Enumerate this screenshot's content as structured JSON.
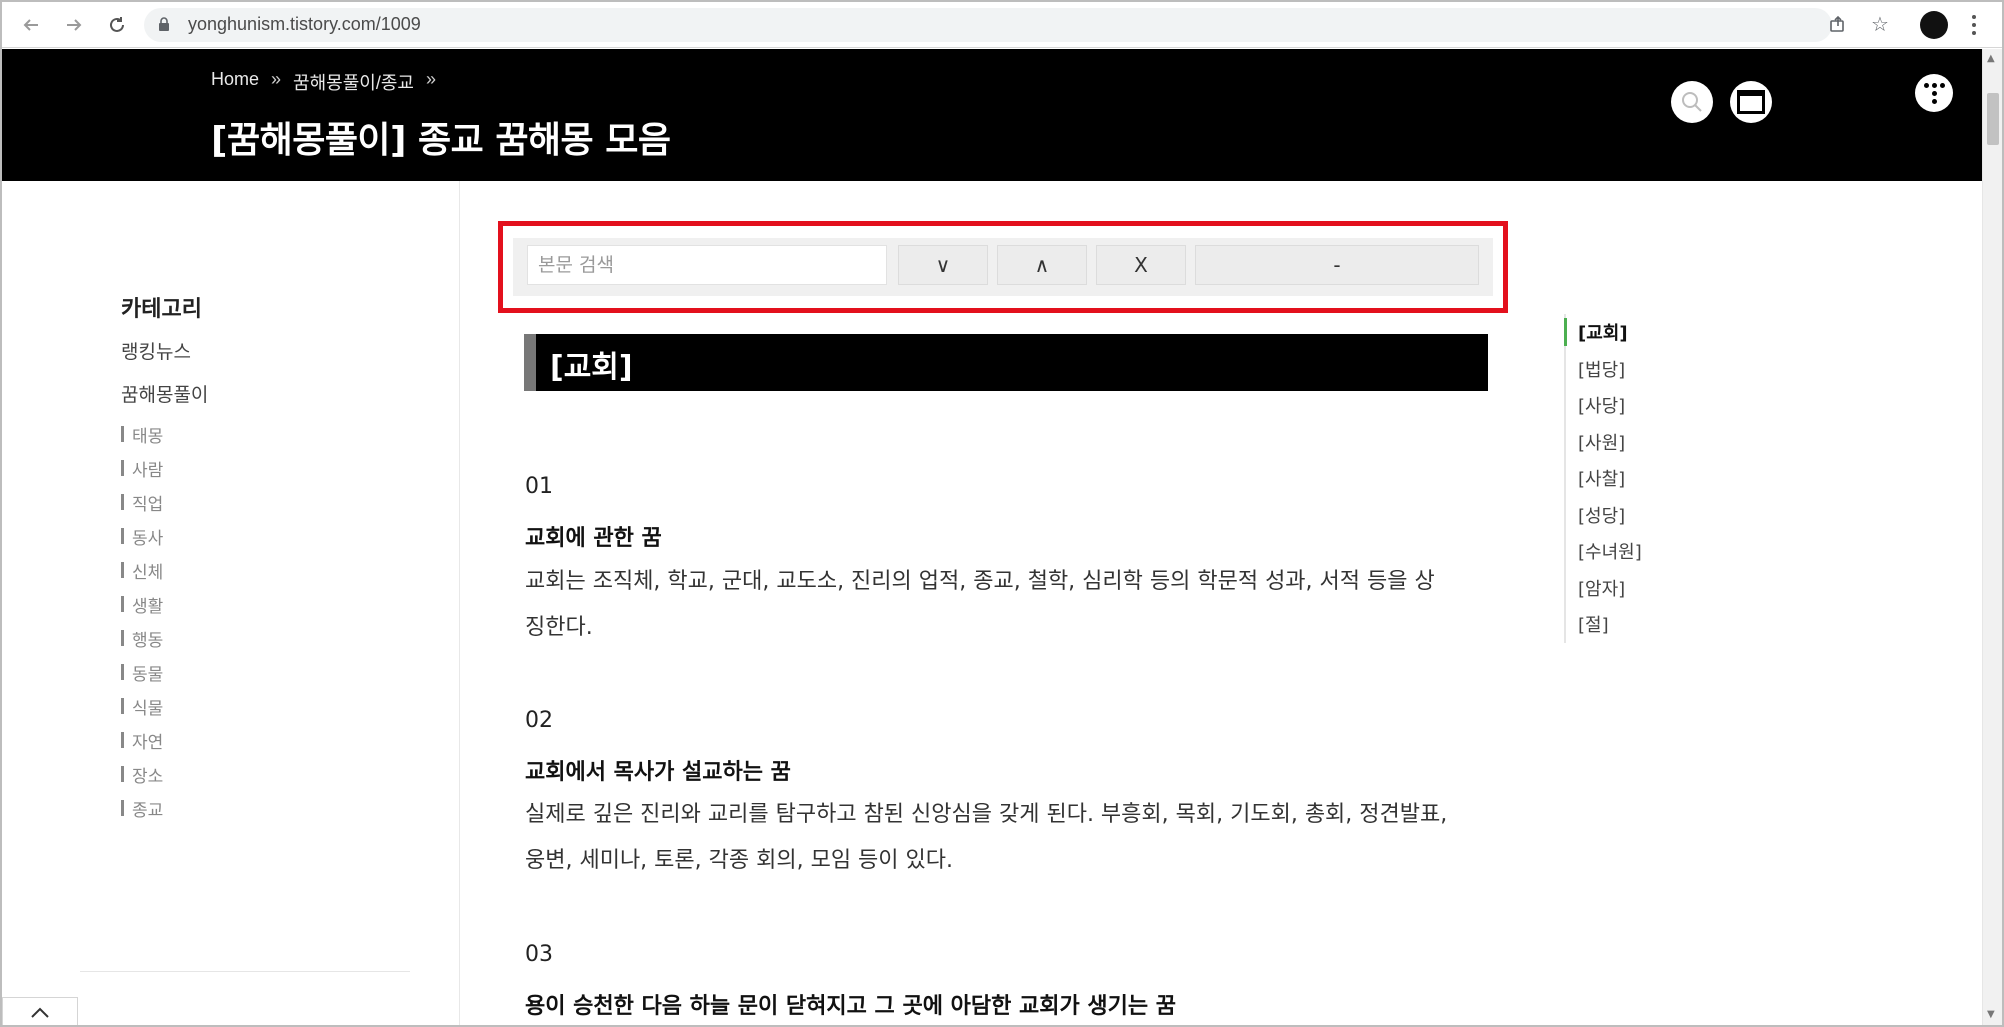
{
  "browser": {
    "url": "yonghunism.tistory.com/1009"
  },
  "header": {
    "breadcrumb": [
      "Home",
      "꿈해몽풀이/종교"
    ],
    "breadcrumb_sep": "»",
    "title": "[꿈해몽풀이] 종교 꿈해몽 모음"
  },
  "sidebar": {
    "category_title": "카테고리",
    "links": [
      "랭킹뉴스",
      "꿈해몽풀이"
    ],
    "sub_items": [
      "태몽",
      "사람",
      "직업",
      "동사",
      "신체",
      "생활",
      "행동",
      "동물",
      "식물",
      "자연",
      "장소",
      "종교"
    ]
  },
  "find": {
    "placeholder": "본문 검색",
    "next_label": "∨",
    "prev_label": "∧",
    "close_label": "X",
    "count_label": "-"
  },
  "content": {
    "section_title": "[교회]",
    "items": [
      {
        "num": "01",
        "title": "교회에 관한 꿈",
        "lines": [
          "교회는 조직체, 학교, 군대, 교도소, 진리의 업적, 종교, 철학, 심리학 등의 학문적 성과, 서적 등을 상",
          "징한다."
        ]
      },
      {
        "num": "02",
        "title": "교회에서 목사가 설교하는 꿈",
        "lines": [
          "실제로 깊은 진리와 교리를 탐구하고 참된 신앙심을 갖게 된다. 부흥회, 목회, 기도회, 총회, 정견발표,",
          "웅변, 세미나, 토론, 각종 회의, 모임 등이 있다."
        ]
      },
      {
        "num": "03",
        "title": "용이 승천한 다음 하늘 문이 닫혀지고 그 곳에 아담한 교회가 생기는 꿈",
        "lines": []
      }
    ]
  },
  "toc": [
    "[교회]",
    "[법당]",
    "[사당]",
    "[사원]",
    "[사찰]",
    "[성당]",
    "[수녀원]",
    "[암자]",
    "[절]"
  ],
  "colors": {
    "header_bg": "#000000",
    "highlight_border": "#e3101d",
    "toc_active": "#4caf50"
  }
}
